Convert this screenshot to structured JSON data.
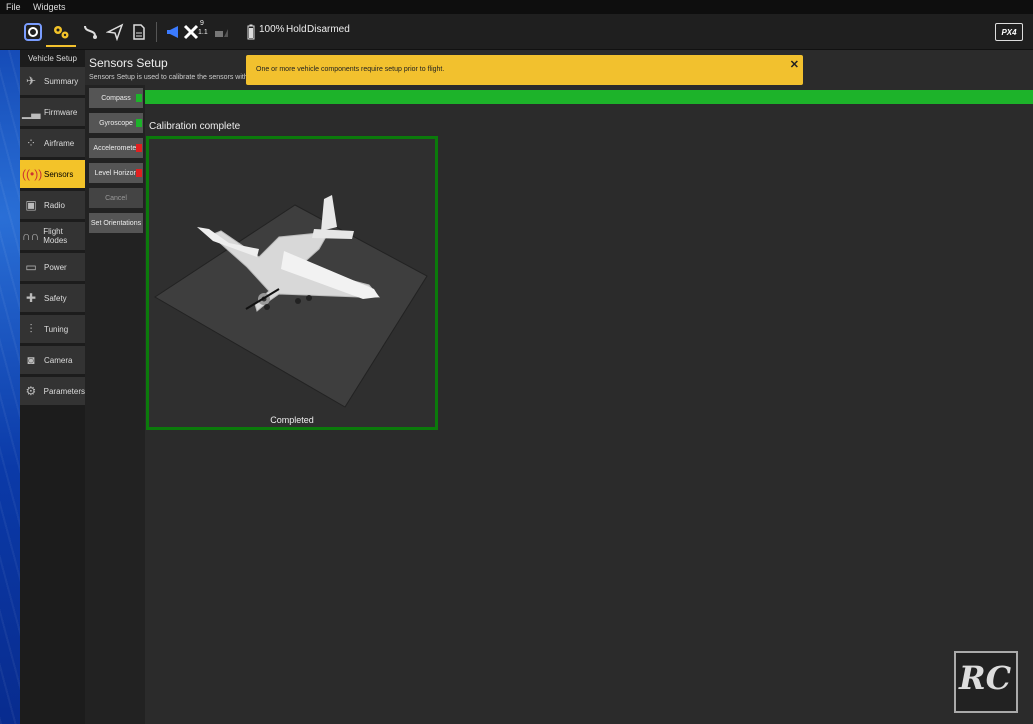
{
  "menu": {
    "file": "File",
    "widgets": "Widgets"
  },
  "toolbar": {
    "icons": [
      "qgc-logo-icon",
      "gear-icon",
      "route-icon",
      "send-icon",
      "document-icon"
    ],
    "gps_count": "9",
    "gps_hdop": "1.1",
    "battery": "100%",
    "flight_mode": "Hold",
    "armed_status": "Disarmed",
    "brand": "PX4"
  },
  "nav": {
    "title": "Vehicle Setup",
    "items": [
      {
        "label": "Summary",
        "icon": "plane-icon"
      },
      {
        "label": "Firmware",
        "icon": "firmware-icon"
      },
      {
        "label": "Airframe",
        "icon": "airframe-icon"
      },
      {
        "label": "Sensors",
        "icon": "sensors-icon",
        "active": true
      },
      {
        "label": "Radio",
        "icon": "radio-icon"
      },
      {
        "label": "Flight Modes",
        "icon": "flight-modes-icon"
      },
      {
        "label": "Power",
        "icon": "battery-icon"
      },
      {
        "label": "Safety",
        "icon": "safety-icon"
      },
      {
        "label": "Tuning",
        "icon": "tuning-icon"
      },
      {
        "label": "Camera",
        "icon": "camera-icon"
      },
      {
        "label": "Parameters",
        "icon": "gears-icon"
      }
    ]
  },
  "page": {
    "title": "Sensors Setup",
    "description": "Sensors Setup is used to calibrate the sensors within"
  },
  "sensors": [
    {
      "label": "Compass",
      "status_color": "#1db32a"
    },
    {
      "label": "Gyroscope",
      "status_color": "#1db32a"
    },
    {
      "label": "Accelerometer",
      "status_color": "#e02020"
    },
    {
      "label": "Level Horizon",
      "status_color": "#e02020"
    },
    {
      "label": "Cancel",
      "disabled": true
    },
    {
      "label": "Set Orientations"
    }
  ],
  "progress": {
    "value": 1.0
  },
  "calibration": {
    "status": "Calibration complete",
    "box_label": "Completed"
  },
  "warning": {
    "message": "One or more vehicle components require setup prior to flight.",
    "close": "✕"
  },
  "colors": {
    "accent": "#f3c329",
    "success": "#1db32a",
    "error": "#e02020",
    "warning_bg": "#f2c12e"
  },
  "watermark": {
    "text": "RC"
  }
}
